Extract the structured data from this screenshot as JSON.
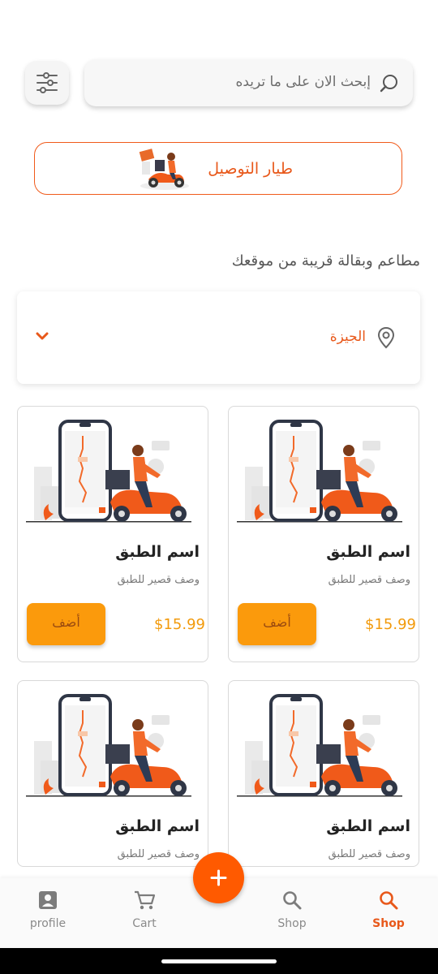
{
  "search": {
    "placeholder": "إبحث الان على ما تريده",
    "icon": "search-icon"
  },
  "filter": {
    "icon": "filter-sliders-icon"
  },
  "delivery": {
    "label": "طيار التوصيل",
    "image": "delivery-scooter-illustration"
  },
  "section": {
    "title": "مطاعم وبقالة قريبة من موقعك"
  },
  "location": {
    "selected": "الجيزة",
    "icon": "location-pin-icon"
  },
  "products": [
    {
      "title": "اسم الطبق",
      "description": "وصف قصير للطبق",
      "price": "$15.99",
      "add_label": "أضف"
    },
    {
      "title": "اسم الطبق",
      "description": "وصف قصير للطبق",
      "price": "$15.99",
      "add_label": "أضف"
    },
    {
      "title": "اسم الطبق",
      "description": "وصف قصير للطبق"
    },
    {
      "title": "اسم الطبق",
      "description": "وصف قصير للطبق"
    }
  ],
  "nav": [
    {
      "label": "profile",
      "icon": "profile-icon"
    },
    {
      "label": "Cart",
      "icon": "cart-icon"
    },
    {
      "label": "Shop",
      "icon": "search-icon"
    },
    {
      "label": "Shop",
      "icon": "search-icon",
      "active": true
    }
  ],
  "fab": {
    "icon": "plus-icon"
  },
  "colors": {
    "accent": "#FF5A00",
    "button": "#FB9A0C",
    "price": "#F29A0C",
    "active": "#E8581A"
  }
}
